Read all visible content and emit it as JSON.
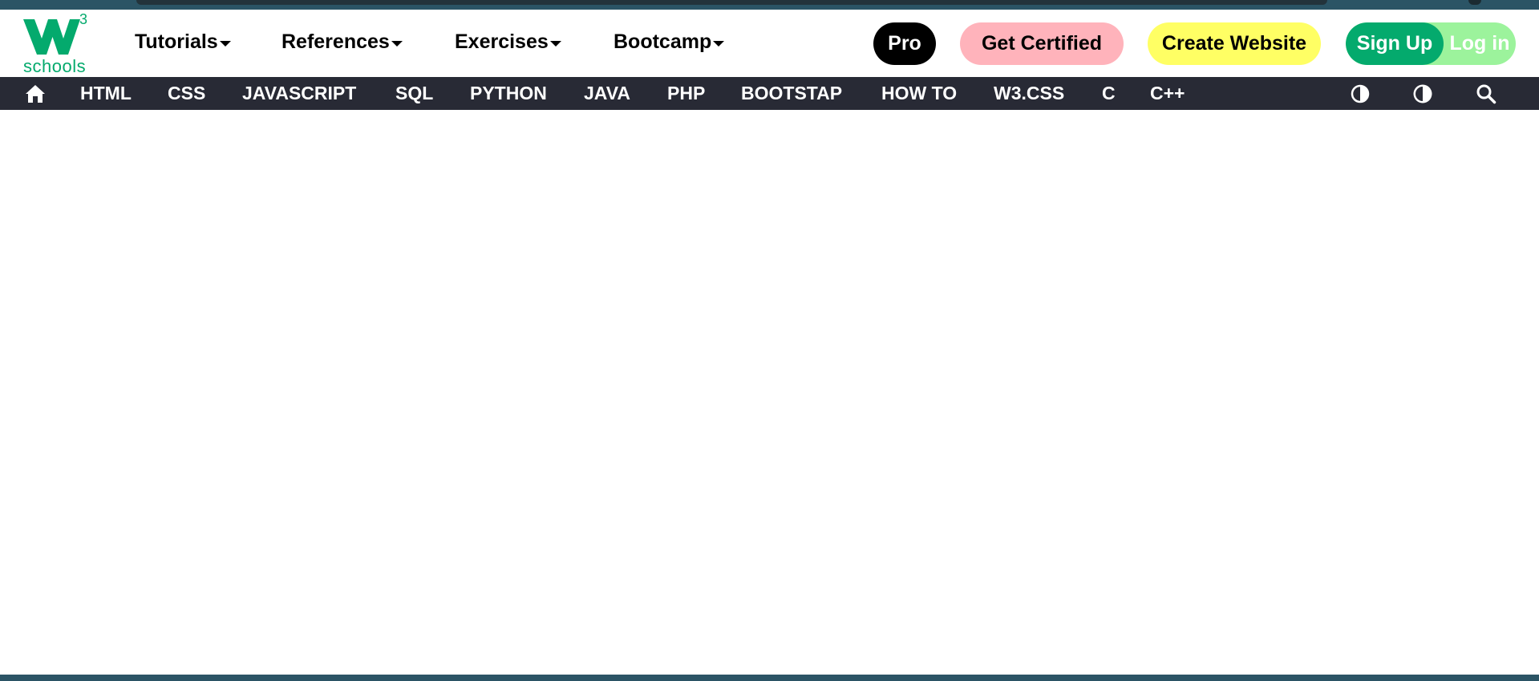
{
  "logo": {
    "mark": "W3",
    "superscript": "3",
    "text": "schools",
    "color": "#04aa6d"
  },
  "topnav": {
    "menus": [
      {
        "label": "Tutorials"
      },
      {
        "label": "References"
      },
      {
        "label": "Exercises"
      },
      {
        "label": "Bootcamp"
      }
    ],
    "pro": "Pro",
    "get_certified": "Get Certified",
    "create_website": "Create Website",
    "sign_up": "Sign Up",
    "log_in": "Log in"
  },
  "subnav": {
    "home_icon": "home-icon",
    "items": [
      "HTML",
      "CSS",
      "JAVASCRIPT",
      "SQL",
      "PYTHON",
      "JAVA",
      "PHP",
      "BOOTSTAP",
      "HOW TO",
      "W3.CSS",
      "C",
      "C++"
    ],
    "right_icons": [
      "contrast-icon",
      "dark-mode-icon",
      "search-icon"
    ]
  },
  "colors": {
    "brand_green": "#04aa6d",
    "subnav_bg": "#282a35",
    "pro_bg": "#000000",
    "certified_bg": "#ffb3bb",
    "create_bg": "#ffff64",
    "login_bg": "#9cf39c"
  }
}
